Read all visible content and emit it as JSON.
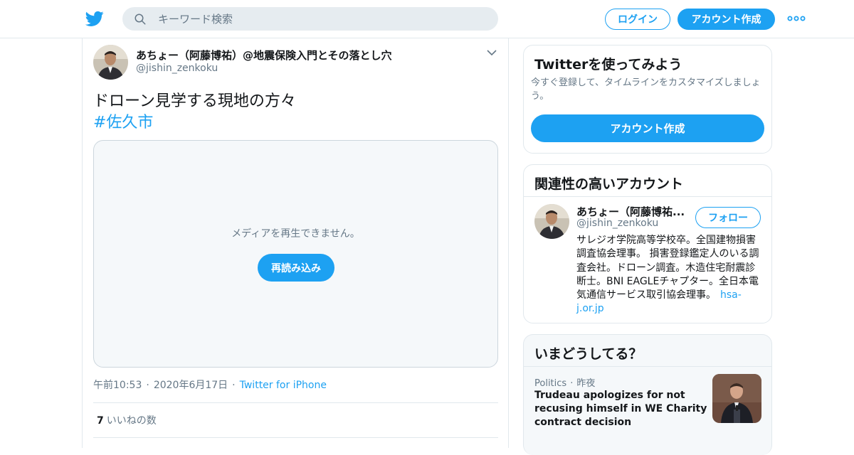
{
  "header": {
    "logo_icon": "twitter-bird-icon",
    "search_placeholder": "キーワード検索",
    "login_label": "ログイン",
    "signup_label": "アカウント作成",
    "more_icon": "more-dots-icon"
  },
  "tweet": {
    "author_name": "あちょー（阿藤博祐）@地震保険入門とその落とし穴",
    "author_handle": "@jishin_zenkoku",
    "text": "ドローン見学する現地の方々",
    "hashtag": "#佐久市",
    "media_message": "メディアを再生できません。",
    "reload_label": "再読み込み",
    "time": "午前10:53",
    "date": "2020年6月17日",
    "source": "Twitter for iPhone",
    "likes_count": "7",
    "likes_label": "いいねの数"
  },
  "signup_card": {
    "title": "Twitterを使ってみよう",
    "description": "今すぐ登録して、タイムラインをカスタマイズしましょう。",
    "button_label": "アカウント作成"
  },
  "related": {
    "title": "関連性の高いアカウント",
    "name": "あちょー（阿藤博祐...",
    "handle": "@jishin_zenkoku",
    "follow_label": "フォロー",
    "bio": "サレジオ学院高等学校卒。全国建物損害調査協会理事。 損害登録鑑定人のいる調査会社。ドローン調査。木造住宅耐震診断士。BNI EAGLEチャプター。全日本電気通信サービス取引協会理事。",
    "bio_link": "hsa-j.or.jp"
  },
  "trends": {
    "title": "いまどうしてる？",
    "category": "Politics",
    "time": "昨夜",
    "headline": "Trudeau apologizes for not recusing himself in WE Charity contract decision"
  },
  "colors": {
    "brand": "#1da1f2",
    "border": "#e1e8ed",
    "secondary_text": "#657786"
  }
}
